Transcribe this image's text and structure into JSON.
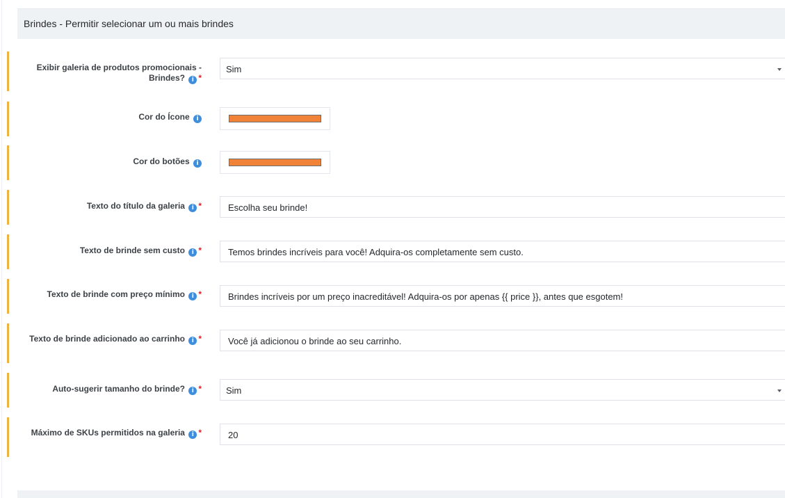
{
  "section": {
    "title": "Brindes - Permitir selecionar um ou mais brindes"
  },
  "info_icon_glyph": "i",
  "required_mark": "*",
  "colors": {
    "accent_bar": "#efb140",
    "info_icon": "#3e8ede",
    "required": "#d9232d",
    "icon_color_value": "#f08338",
    "buttons_color_value": "#f08338"
  },
  "fields": {
    "show_gallery": {
      "label": "Exibir galeria de produtos promocionais - Brindes?",
      "value": "Sim",
      "type": "select",
      "required": true
    },
    "icon_color": {
      "label": "Cor do Ícone",
      "type": "color"
    },
    "buttons_color": {
      "label": "Cor do botões",
      "type": "color"
    },
    "gallery_title": {
      "label": "Texto do título da galeria",
      "value": "Escolha seu brinde!",
      "required": true
    },
    "free_gift_text": {
      "label": "Texto de brinde sem custo",
      "value": "Temos brindes incríveis para você! Adquira-os completamente sem custo.",
      "required": true
    },
    "min_price_gift_text": {
      "label": "Texto de brinde com preço mínimo",
      "value": "Brindes incríveis por um preço inacreditável! Adquira-os por apenas {{ price }}, antes que esgotem!",
      "required": true
    },
    "gift_added_text": {
      "label": "Texto de brinde adicionado ao carrinho",
      "value": "Você já adicionou o brinde ao seu carrinho.",
      "required": true
    },
    "auto_suggest_size": {
      "label": "Auto-sugerir tamanho do brinde?",
      "value": "Sim",
      "type": "select",
      "required": true
    },
    "max_skus": {
      "label": "Máximo de SKUs permitidos na galeria",
      "value": "20",
      "required": true
    }
  },
  "icons": {
    "info": "info-icon",
    "dropdown": "chevron-down-icon"
  }
}
